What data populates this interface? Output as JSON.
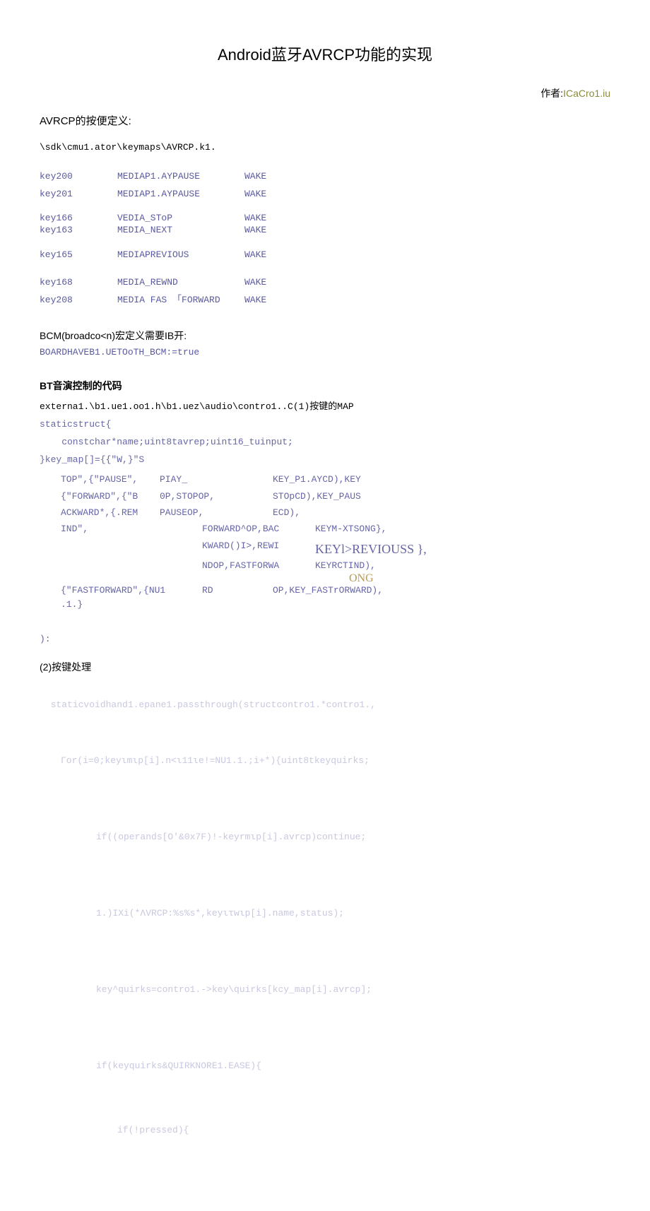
{
  "title": "Android蓝牙AVRCP功能的实现",
  "author_label": "作者:",
  "author_name": "ICaCro1.iu",
  "sec1": "AVRCP的按便定义:",
  "path_line": "\\sdk\\cmu1.ator\\keymaps\\AVRCP.k1.",
  "keytable": [
    {
      "k": "key200",
      "v": "MEDIAP1.AYPAUSE",
      "w": "WAKE"
    },
    {
      "k": "key201",
      "v": "MEDIAP1.AYPAUSE",
      "w": "WAKE"
    },
    {
      "k": "key166",
      "v": "VEDIA_SToP",
      "w": "WAKE"
    },
    {
      "k": "key163",
      "v": "MEDIA_NEXT",
      "w": "WAKE"
    },
    {
      "k": "key165",
      "v": "MEDIAPREVIOUS",
      "w": "WAKE"
    },
    {
      "k": "key168",
      "v": "MEDIA_REWND",
      "w": "WAKE"
    },
    {
      "k": "key208",
      "v": "MEDIA FAS 「FORWARD",
      "w": "WAKE"
    }
  ],
  "bcm_header": "BCM(broadco<n)宏定义需要IB开:",
  "bcm_code": "BOARDHAVEB1.UETOoTH_BCM:=true",
  "bt_header": "BT音演控制的代码",
  "ext_line_prefix": "externa1.\\b1.ue1.oo1.h\\b1.uez\\audio\\contro1..C(1)",
  "ext_line_suffix": "按键的MAP",
  "struct_line": "staticstruct{",
  "struct_body": "    constchar*name;uint8tavrep;uint16_tuinput;",
  "struct_close": "}key_map[]={{\"W,}\"S",
  "km": {
    "r1": {
      "c1": "TOP\",{\"PAUSE\",",
      "c2": "PIAY_",
      "c3": "KEY_P1.AYCD),KEY"
    },
    "r2": {
      "c1": "{\"FORWARD\",{\"B",
      "c2": "0P,STOPOP,",
      "c3": "STOpCD),KEY_PAUS"
    },
    "r3": {
      "c1": "ACKWARD*,{.REM",
      "c2": "PAUSEOP,",
      "c3": "ECD),"
    },
    "r4": {
      "c1": "IND\",",
      "c2": "FORWARD^OP,BAC",
      "c4": "KEYM-XTSONG},"
    },
    "r5": {
      "c2": "KWARD()I>,REWI",
      "c4": "KEYl>REVIOUSS   },"
    },
    "r6": {
      "c2": "NDOP,FASTFORWA",
      "c3": "KEYRCTIND),",
      "ong": "ONG"
    },
    "r7": {
      "c1": "{\"FASTFORWARD\",{NU1",
      "c2": "RD",
      "c3": "OP,KEY_FASTrORWARD),"
    },
    "r8": {
      "c1": ".1.}"
    }
  },
  "km_close": "):",
  "sec2_prefix": "(2)",
  "sec2_text": "按键处理",
  "faded": {
    "l1": "staticvoidhand1.epane1.passthrough(structcontro1.*contro1.,",
    "l2": "Гor(i=0;keyιmιp[i].n<ι11ιe!=NU1.1.;i+*){uint8tkeyquirks;",
    "l3": "if((operands[O'&0x7F)!-keyrmιp[i].avrcp)continue;",
    "l4": "1.)IXi(*ΛVRCP:%s%s*,keyιτwιp[i].name,status);",
    "l5": "key^quirks=contro1.->key\\quirks[kcy_map[i].avrcp];",
    "l6": "if(keyquirks&QUIRKNORE1.EASE){",
    "l7": "if(!pressed){"
  }
}
